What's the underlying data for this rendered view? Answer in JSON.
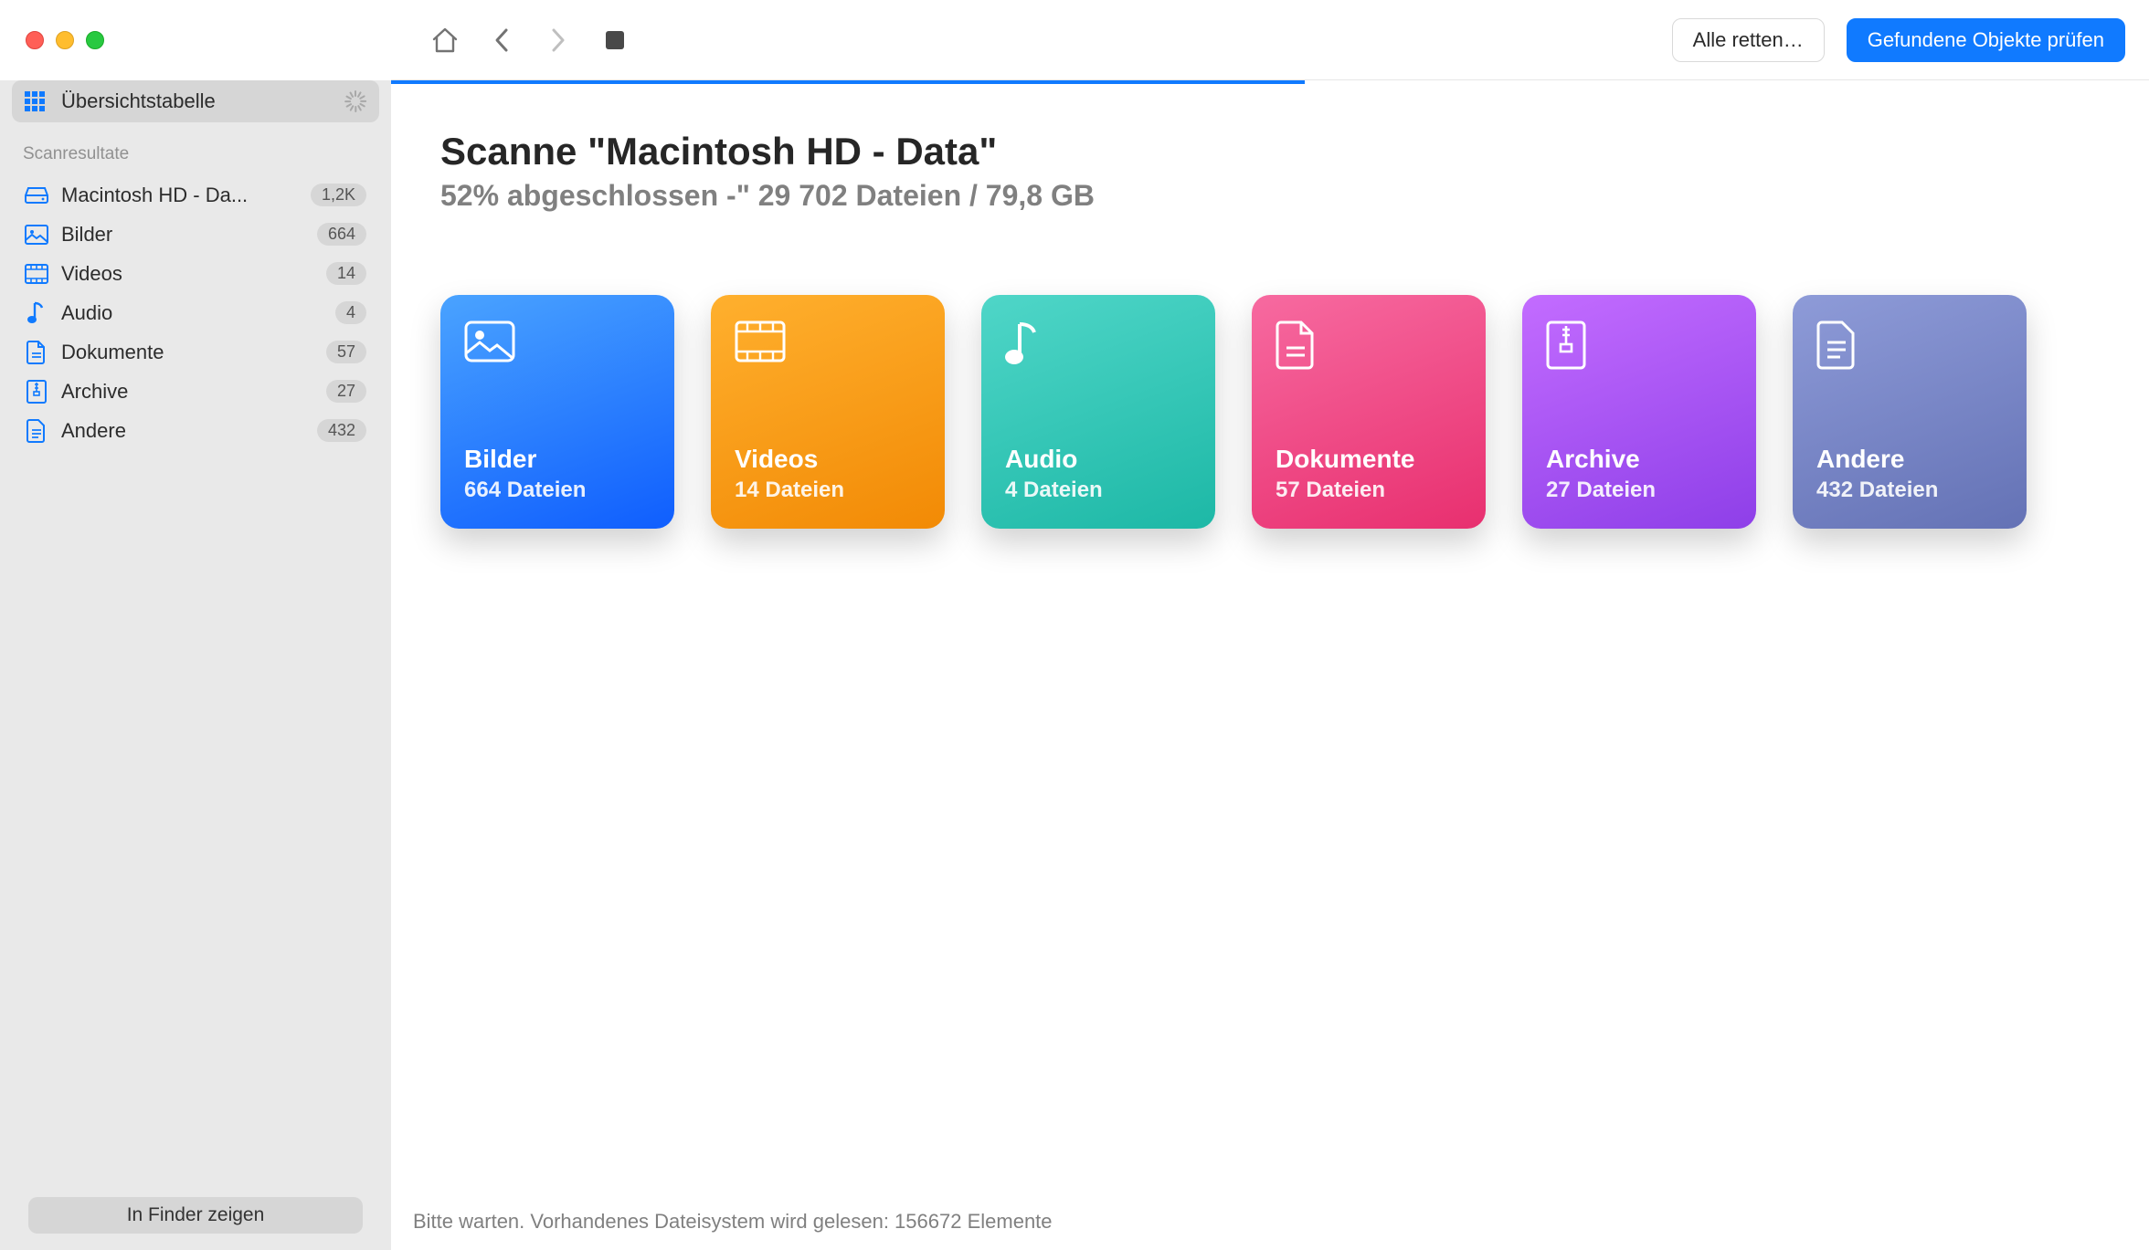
{
  "sidebar": {
    "top_label": "Übersichtstabelle",
    "results_header": "Scanresultate",
    "items": [
      {
        "label": "Macintosh HD - Da...",
        "badge": "1,2K"
      },
      {
        "label": "Bilder",
        "badge": "664"
      },
      {
        "label": "Videos",
        "badge": "14"
      },
      {
        "label": "Audio",
        "badge": "4"
      },
      {
        "label": "Dokumente",
        "badge": "57"
      },
      {
        "label": "Archive",
        "badge": "27"
      },
      {
        "label": "Andere",
        "badge": "432"
      }
    ],
    "finder_button": "In Finder zeigen"
  },
  "toolbar": {
    "recover_all": "Alle retten…",
    "review": "Gefundene Objekte prüfen"
  },
  "main": {
    "title": "Scanne \"Macintosh HD - Data\"",
    "subtitle": "52% abgeschlossen -\" 29 702 Dateien / 79,8 GB",
    "progress_percent": 52
  },
  "cards": [
    {
      "title": "Bilder",
      "subtitle": "664 Dateien"
    },
    {
      "title": "Videos",
      "subtitle": "14 Dateien"
    },
    {
      "title": "Audio",
      "subtitle": "4 Dateien"
    },
    {
      "title": "Dokumente",
      "subtitle": "57 Dateien"
    },
    {
      "title": "Archive",
      "subtitle": "27 Dateien"
    },
    {
      "title": "Andere",
      "subtitle": "432 Dateien"
    }
  ],
  "status": "Bitte warten. Vorhandenes Dateisystem wird gelesen: 156672 Elemente"
}
